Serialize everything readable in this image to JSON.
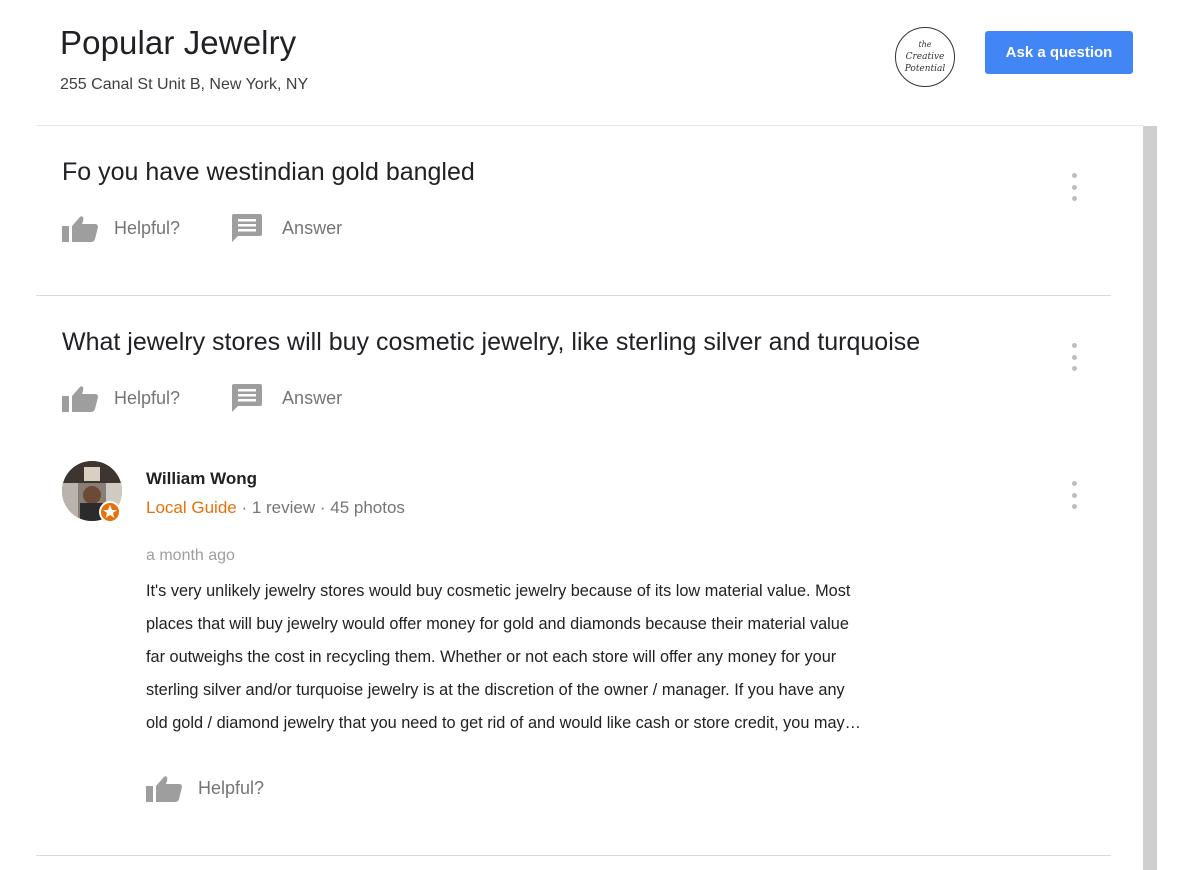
{
  "place": {
    "name": "Popular Jewelry",
    "address": "255 Canal St Unit B, New York, NY"
  },
  "header": {
    "ask_button_label": "Ask a question",
    "profile_logo_text": "the Creative Potential"
  },
  "questions": [
    {
      "text": "Fo you have westindian gold bangled",
      "helpful_label": "Helpful?",
      "answer_label": "Answer"
    },
    {
      "text": "What jewelry stores will buy cosmetic jewelry, like sterling silver and turquoise",
      "helpful_label": "Helpful?",
      "answer_label": "Answer",
      "answer": {
        "author": "William Wong",
        "badge": "Local Guide",
        "stats": " · 1 review · 45 photos",
        "time": "a month ago",
        "lines": [
          "It's very unlikely jewelry stores would buy cosmetic jewelry because of its low material value. Most",
          "places that will buy jewelry would offer money for gold and diamonds because their material value",
          "far outweighs the cost in recycling them. Whether or not each store will offer any money for your",
          "sterling silver and/or turquoise jewelry is at the discretion of the owner / manager. If you have any",
          "old gold / diamond jewelry that you need to get rid of and would like cash or store credit, you may…"
        ],
        "helpful_label": "Helpful?"
      }
    }
  ],
  "icons": {
    "thumb": "thumbs-up-icon",
    "answer": "comment-icon",
    "more": "more-vert-icon"
  },
  "colors": {
    "primary_button": "#4285f4",
    "local_guide": "#e8710a",
    "icon_gray": "#9e9e9e"
  }
}
